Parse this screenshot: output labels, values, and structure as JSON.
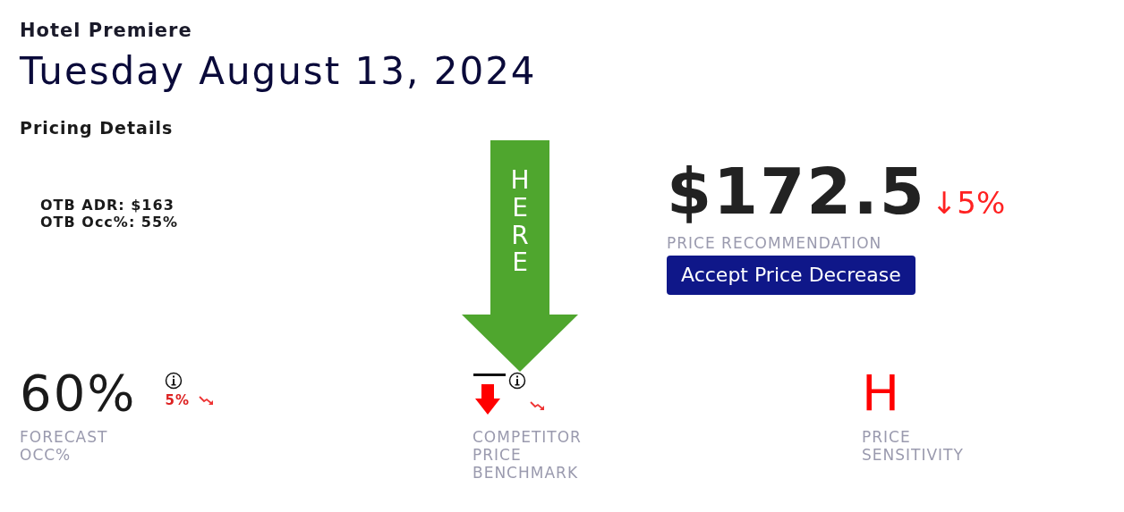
{
  "hotel": "Hotel Premiere",
  "date": "Tuesday August 13, 2024",
  "section": "Pricing Details",
  "otb": [
    "OTB ADR: $163",
    "OTB Occ%: 55%"
  ],
  "recommendation": {
    "price": "$172.5",
    "change": "↓5%",
    "label": "PRICE RECOMMENDATION",
    "button": "Accept Price Decrease"
  },
  "annotation": {
    "text": "HERE"
  },
  "metrics": [
    {
      "kind": "value",
      "value": "60%",
      "change": "5%",
      "label": [
        "FORECAST",
        "OCC%"
      ]
    },
    {
      "kind": "arrow",
      "label": [
        "COMPETITOR",
        "PRICE",
        "BENCHMARK"
      ]
    },
    {
      "kind": "letter",
      "value": "H",
      "label": [
        "PRICE",
        "SENSITIVITY"
      ]
    }
  ]
}
